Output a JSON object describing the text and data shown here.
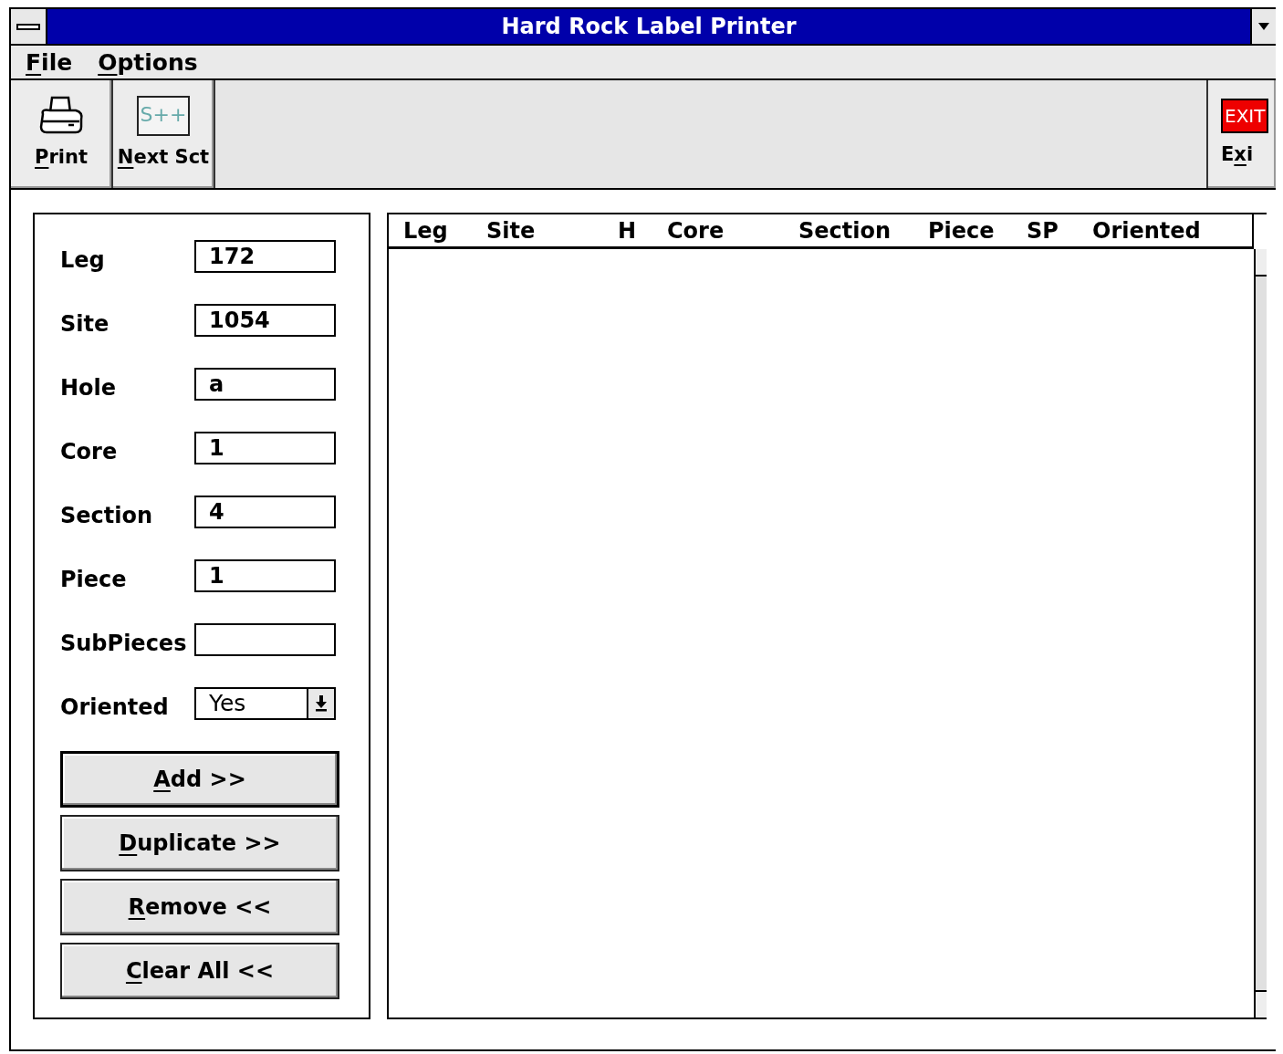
{
  "window": {
    "title": "Hard Rock Label Printer"
  },
  "menu": [
    {
      "accel": "F",
      "after": "ile"
    },
    {
      "accel": "O",
      "after": "ptions"
    }
  ],
  "toolbar": [
    {
      "kind": "print",
      "accel": "P",
      "after": "rint"
    },
    {
      "kind": "next",
      "icon_text": "S++",
      "accel": "N",
      "after": "ext Sct"
    }
  ],
  "exit_button": {
    "icon_text": "EXIT",
    "before": "E",
    "accel": "x",
    "after": "i"
  },
  "form": {
    "fields": [
      {
        "label": "Leg",
        "value": "172",
        "kind": "text"
      },
      {
        "label": "Site",
        "value": "1054",
        "kind": "text"
      },
      {
        "label": "Hole",
        "value": "a",
        "kind": "text"
      },
      {
        "label": "Core",
        "value": "1",
        "kind": "text"
      },
      {
        "label": "Section",
        "value": "4",
        "kind": "text"
      },
      {
        "label": "Piece",
        "value": "1",
        "kind": "text"
      },
      {
        "label": "SubPieces",
        "kind": "text"
      },
      {
        "label": "Oriented",
        "value": "Yes",
        "kind": "dropdown"
      }
    ],
    "buttons": [
      {
        "accel": "A",
        "after": "dd >>",
        "default": true
      },
      {
        "accel": "D",
        "after": "uplicate >>",
        "default": false
      },
      {
        "accel": "R",
        "after": "emove <<",
        "default": false
      },
      {
        "accel": "C",
        "after": "lear All <<",
        "default": false
      }
    ]
  },
  "list": {
    "columns": [
      "Leg",
      "Site",
      "H",
      "Core",
      "Section",
      "Piece",
      "SP",
      "Oriented"
    ]
  }
}
